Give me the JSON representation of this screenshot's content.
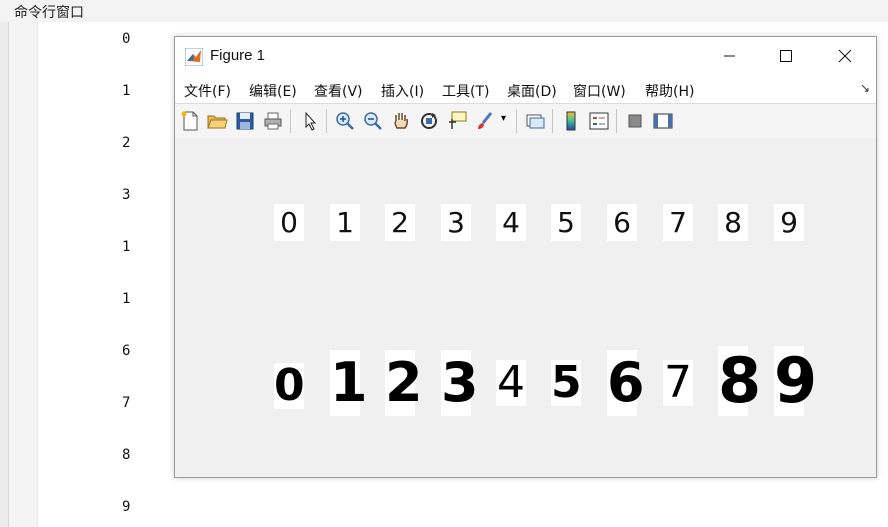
{
  "command_window": {
    "title": "命令行窗口",
    "outputs": [
      "0",
      "1",
      "2",
      "3",
      "1",
      "1",
      "6",
      "7",
      "8",
      "9"
    ]
  },
  "figure": {
    "title": "Figure 1",
    "menu": [
      "文件(F)",
      "编辑(E)",
      "查看(V)",
      "插入(I)",
      "工具(T)",
      "桌面(D)",
      "窗口(W)",
      "帮助(H)"
    ],
    "toolbar_icons": [
      "new-figure-icon",
      "open-file-icon",
      "save-icon",
      "print-icon",
      "pointer-icon",
      "zoom-in-icon",
      "zoom-out-icon",
      "pan-hand-icon",
      "rotate-3d-icon",
      "data-cursor-icon",
      "brush-icon",
      "link-icon",
      "colorbar-icon",
      "legend-icon",
      "hide-plot-tools-icon",
      "show-plot-tools-icon"
    ],
    "row1_digits": [
      "0",
      "1",
      "2",
      "3",
      "4",
      "5",
      "6",
      "7",
      "8",
      "9"
    ],
    "row2_digits": [
      "0",
      "1",
      "2",
      "3",
      "4",
      "5",
      "6",
      "7",
      "8",
      "9"
    ]
  }
}
